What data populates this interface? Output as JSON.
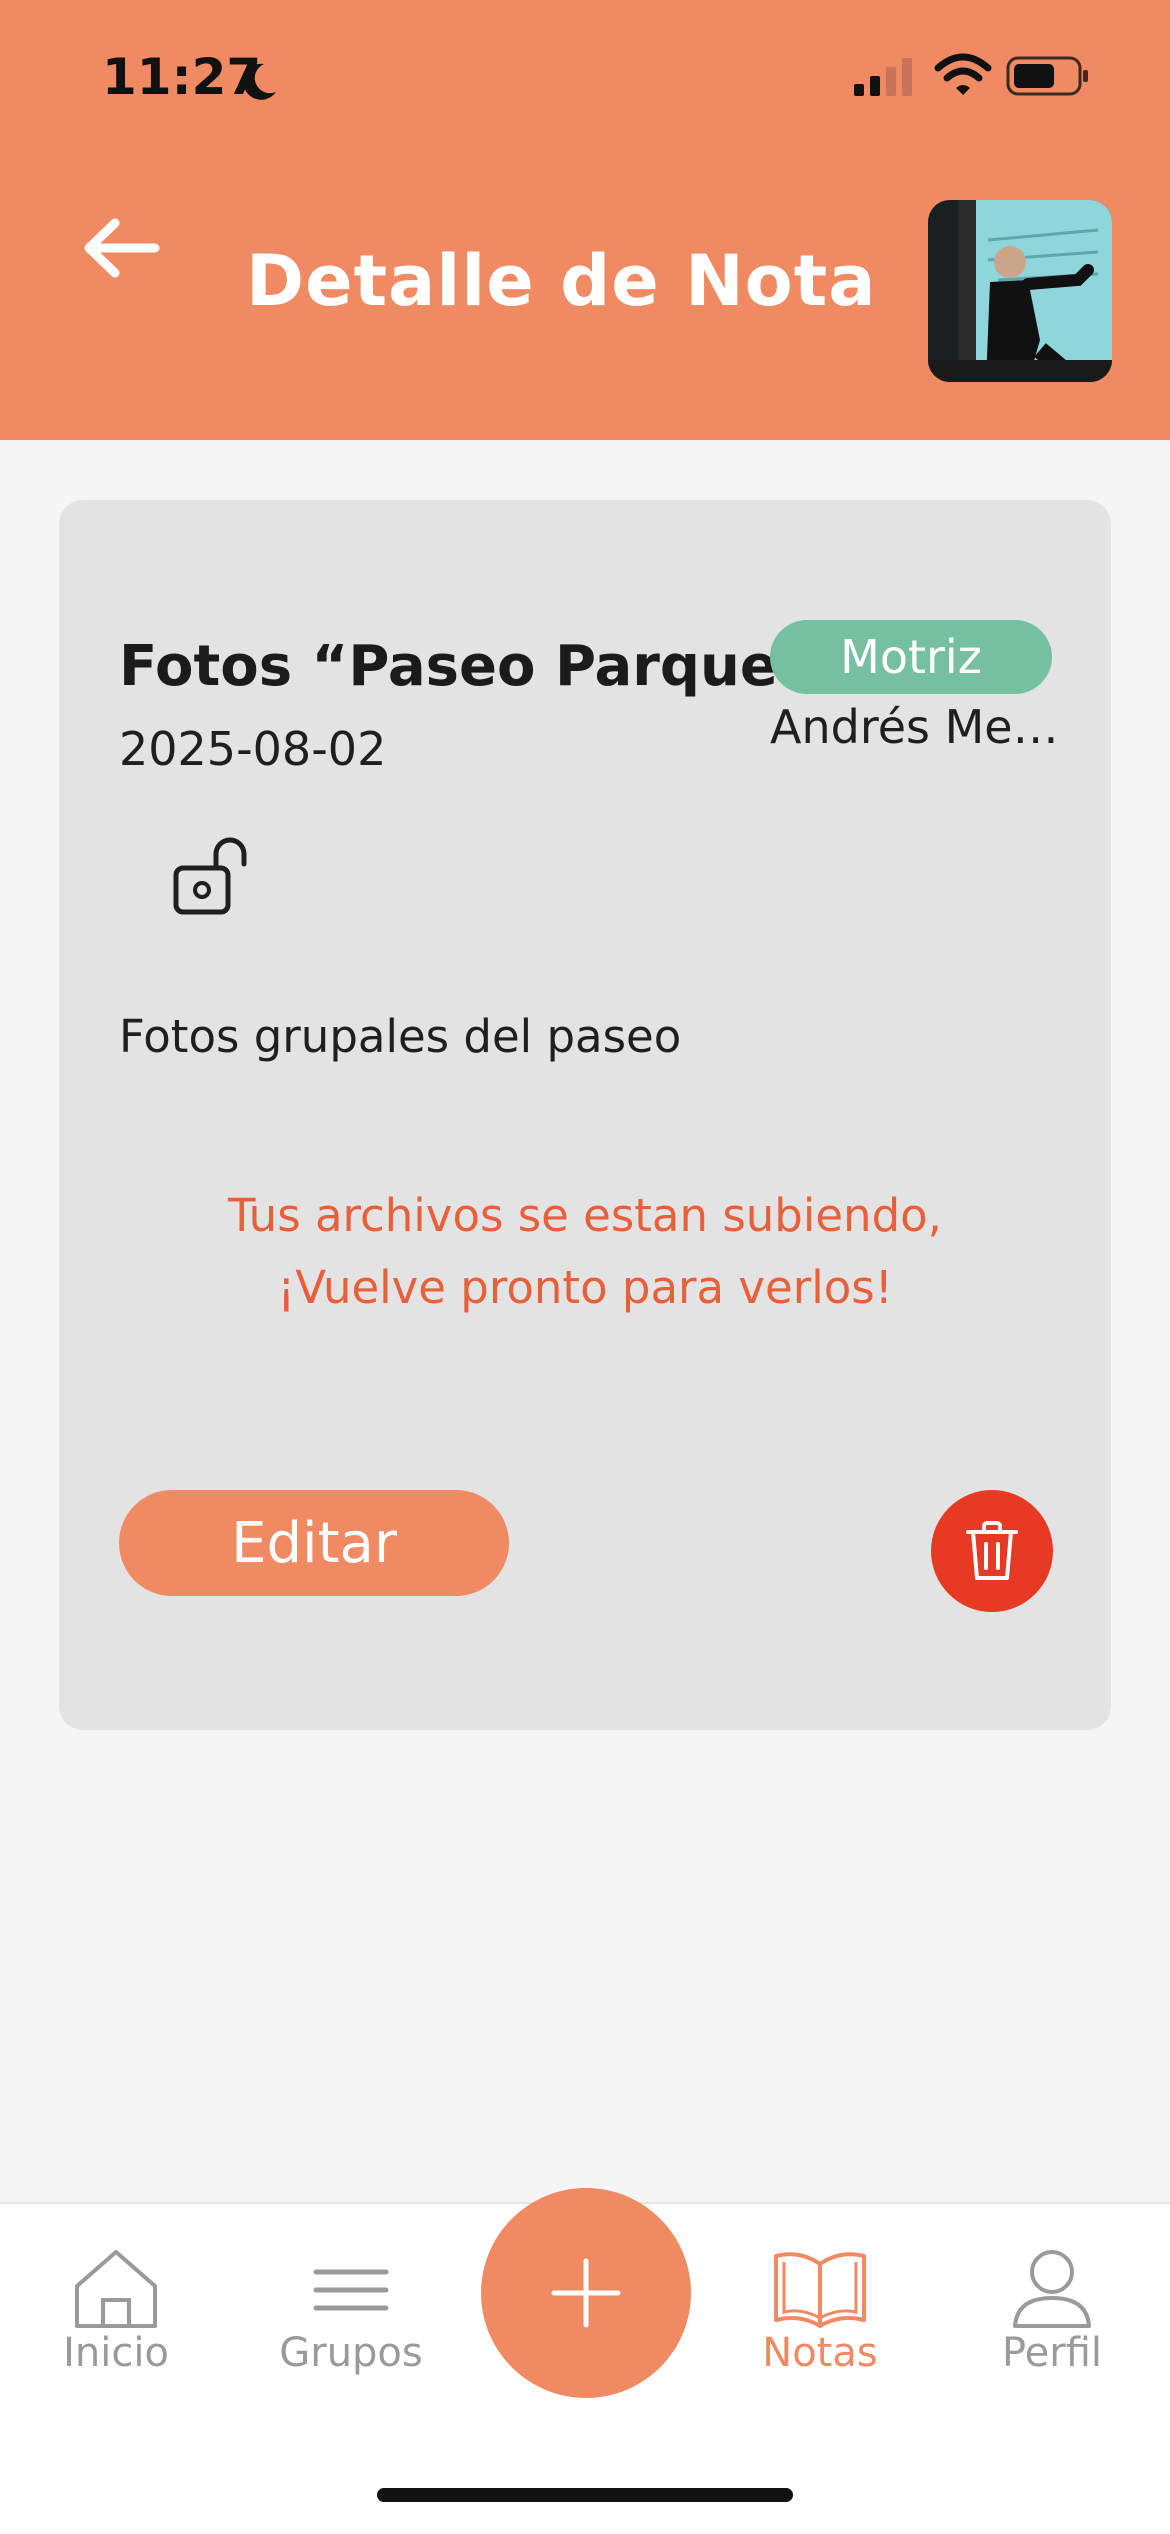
{
  "status_bar": {
    "time": "11:27"
  },
  "header": {
    "title": "Detalle de Nota",
    "back_icon": "arrow-left-icon",
    "avatar": "user-avatar-photo"
  },
  "note": {
    "title": "Fotos “Paseo Parque”",
    "date": "2025-08-02",
    "category": "Motriz",
    "author": "Andrés Me…",
    "privacy_icon": "unlocked-icon",
    "description": "Fotos grupales del paseo",
    "upload_message_line1": "Tus archivos se estan subiendo,",
    "upload_message_line2": "¡Vuelve pronto para verlos!",
    "edit_label": "Editar",
    "delete_icon": "trash-icon"
  },
  "bottom_nav": {
    "items": [
      {
        "label": "Inicio",
        "icon": "home-icon",
        "active": false
      },
      {
        "label": "Grupos",
        "icon": "menu-icon",
        "active": false
      },
      {
        "label": "Notas",
        "icon": "book-icon",
        "active": true
      },
      {
        "label": "Perfil",
        "icon": "user-icon",
        "active": false
      }
    ],
    "add_icon": "plus-icon"
  },
  "colors": {
    "primary": "#f08a63",
    "badge": "#76c0a2",
    "danger": "#e63a24",
    "warning_text": "#e8603b",
    "card_bg": "#e3e3e3",
    "page_bg": "#f5f5f5"
  }
}
